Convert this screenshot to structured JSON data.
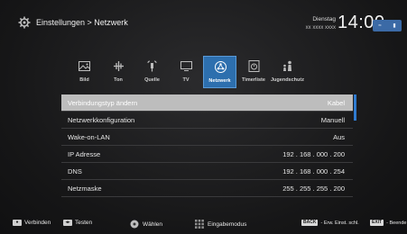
{
  "header": {
    "breadcrumb": "Einstellungen > Netzwerk",
    "day": "Dienstag",
    "date": "xx xxxx xxxx",
    "time": "14:00"
  },
  "tabs": [
    {
      "label": "Bild",
      "icon": "picture-icon"
    },
    {
      "label": "Ton",
      "icon": "sound-icon"
    },
    {
      "label": "Quelle",
      "icon": "source-icon"
    },
    {
      "label": "TV",
      "icon": "tv-icon"
    },
    {
      "label": "Netzwerk",
      "icon": "network-icon",
      "active": true
    },
    {
      "label": "Timerliste",
      "icon": "timer-icon"
    },
    {
      "label": "Jugendschutz",
      "icon": "parental-icon"
    }
  ],
  "settings": [
    {
      "label": "Verbindungstyp ändern",
      "value": "Kabel",
      "selected": true
    },
    {
      "label": "Netzwerkkonfiguration",
      "value": "Manuell"
    },
    {
      "label": "Wake-on-LAN",
      "value": "Aus"
    },
    {
      "label": "IP Adresse",
      "value": "192 . 168 . 000 . 200"
    },
    {
      "label": "DNS",
      "value": "192 . 168 . 000 . 254"
    },
    {
      "label": "Netzmaske",
      "value": "255 . 255 . 255 . 200"
    }
  ],
  "footer": {
    "connect": "Verbinden",
    "test": "Testen",
    "select": "Wählen",
    "input_mode": "Eingabemodus",
    "back_key": "BACK",
    "back_label": "- Erw. Einst. schl.",
    "exit_key": "EXIT",
    "exit_label": "- Beende"
  },
  "colors": {
    "accent": "#2d6fae",
    "selection": "#bdbdbd",
    "status_box": "#3b6aa6"
  }
}
